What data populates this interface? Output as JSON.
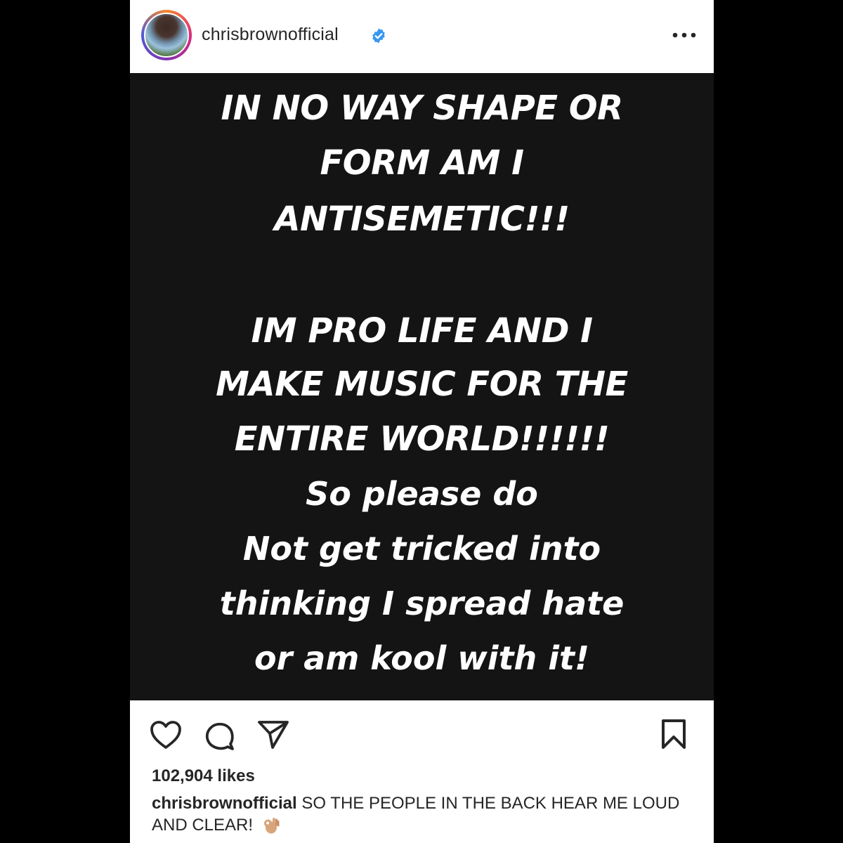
{
  "post": {
    "username": "chrisbrownofficial",
    "verified_icon": "verified-badge-icon",
    "more_icon": "more-options-icon",
    "image_text_lines": [
      "IN NO WAY SHAPE OR",
      "FORM AM I",
      "ANTISEMETIC!!!",
      "IM PRO LIFE AND I",
      "MAKE MUSIC FOR THE",
      "ENTIRE WORLD!!!!!!",
      "So please do",
      "Not get tricked into",
      "thinking I spread hate",
      "or am kool with it!"
    ],
    "actions": {
      "like_icon": "heart-icon",
      "comment_icon": "comment-icon",
      "share_icon": "send-icon",
      "save_icon": "bookmark-icon"
    },
    "likes": "102,904 likes",
    "caption_user": "chrisbrownofficial",
    "caption_text": "SO THE PEOPLE IN THE BACK HEAR ME LOUD AND CLEAR!",
    "caption_emoji": "ok-hand-emoji"
  },
  "colors": {
    "verified_blue": "#3897f0",
    "text_dark": "#262626",
    "post_background": "#141414"
  }
}
